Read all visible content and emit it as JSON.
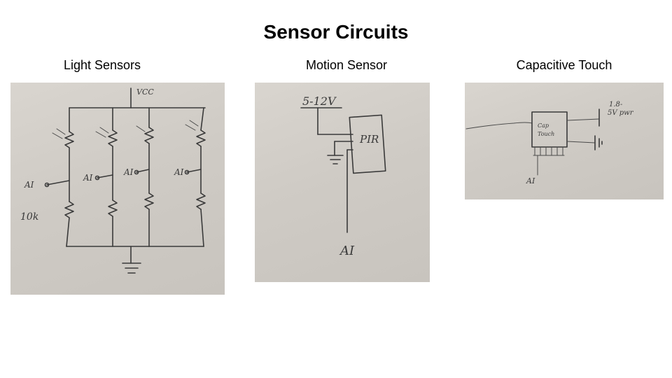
{
  "title": "Sensor Circuits",
  "panels": [
    {
      "label": "Light Sensors",
      "sketch": {
        "supply": "VCC",
        "inputs": [
          "AI",
          "AI",
          "AI",
          "AI"
        ],
        "resistor": "10k"
      }
    },
    {
      "label": "Motion Sensor",
      "sketch": {
        "supply": "5-12V",
        "device": "PIR",
        "input": "AI"
      }
    },
    {
      "label": "Capacitive Touch",
      "sketch": {
        "device_line1": "Cap",
        "device_line2": "Touch",
        "power_line1": "1.8-",
        "power_line2": "5V pwr",
        "input": "AI"
      }
    }
  ]
}
